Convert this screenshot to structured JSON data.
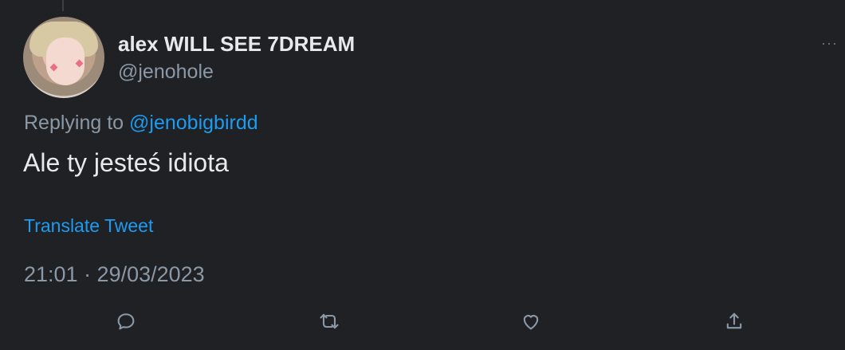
{
  "tweet": {
    "display_name": "alex WILL SEE 7DREAM",
    "handle": "@jenohole",
    "replying_label": "Replying to",
    "replying_to": "@jenobigbirdd",
    "text": "Ale ty jesteś idiota",
    "translate_label": "Translate Tweet",
    "timestamp": "21:01 · 29/03/2023",
    "more_label": "···"
  },
  "colors": {
    "background": "#1f2125",
    "primary_text": "#e7e9ea",
    "secondary_text": "#8b98a5",
    "accent": "#1d9bf0"
  },
  "actions": [
    {
      "icon": "reply-icon"
    },
    {
      "icon": "retweet-icon"
    },
    {
      "icon": "like-icon"
    },
    {
      "icon": "share-icon"
    }
  ]
}
